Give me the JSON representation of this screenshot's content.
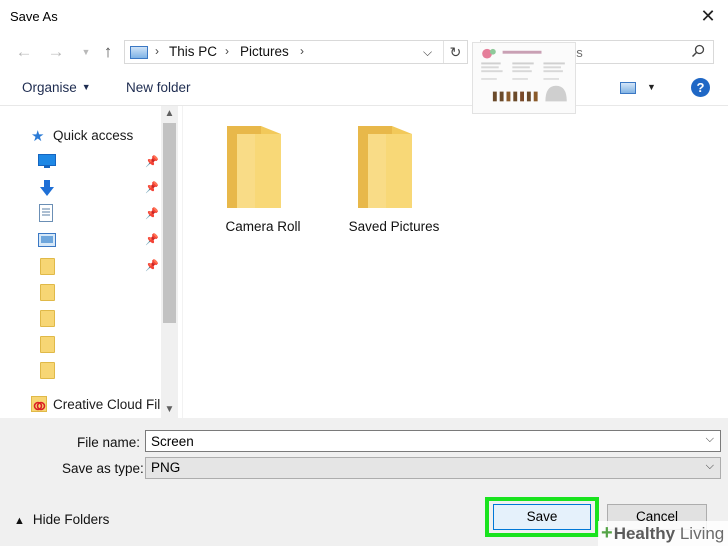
{
  "window": {
    "title": "Save As"
  },
  "address": {
    "crumbs": [
      "This PC",
      "Pictures"
    ]
  },
  "search": {
    "placeholder": "Search Pictures"
  },
  "toolbar": {
    "organise": "Organise",
    "new_folder": "New folder"
  },
  "nav": {
    "quick_access": "Quick access",
    "creative_cloud": "Creative Cloud Fil"
  },
  "files": [
    {
      "name": "Camera Roll",
      "type": "folder"
    },
    {
      "name": "Saved Pictures",
      "type": "folder"
    },
    {
      "name": "",
      "type": "image-thumbnail"
    }
  ],
  "form": {
    "file_name_label": "File name:",
    "file_name_value": "Screen",
    "save_type_label": "Save as type:",
    "save_type_value": "PNG"
  },
  "footer": {
    "hide_folders": "Hide Folders",
    "save": "Save",
    "cancel": "Cancel"
  },
  "watermark": {
    "text1": "Healthy",
    "text2": " Living"
  },
  "colors": {
    "highlight": "#19e31e",
    "folder": "#f7d674",
    "accent": "#1f67c5"
  }
}
